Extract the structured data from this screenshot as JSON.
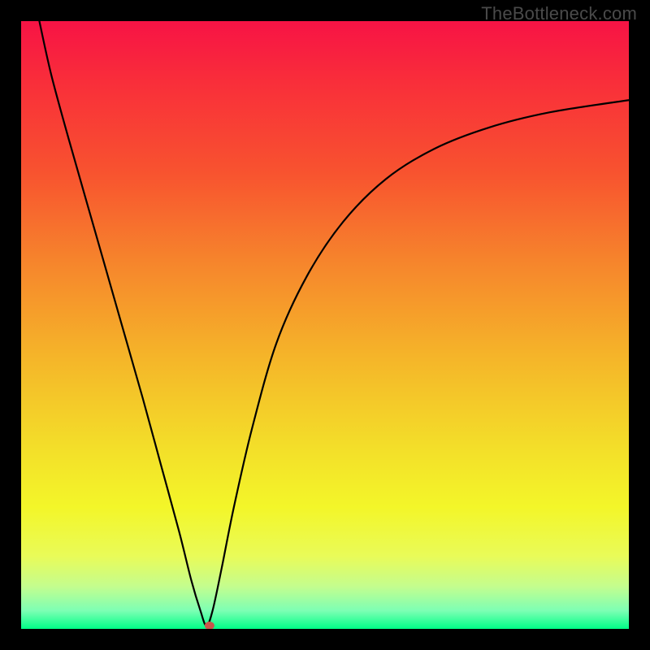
{
  "watermark": "TheBottleneck.com",
  "chart_data": {
    "type": "line",
    "title": "",
    "xlabel": "",
    "ylabel": "",
    "xlim": [
      0,
      100
    ],
    "ylim": [
      0,
      100
    ],
    "grid": false,
    "legend": false,
    "gradient_stops": [
      {
        "offset": 0.0,
        "color": "#f71345"
      },
      {
        "offset": 0.1,
        "color": "#f92e3a"
      },
      {
        "offset": 0.25,
        "color": "#f8532f"
      },
      {
        "offset": 0.4,
        "color": "#f6862c"
      },
      {
        "offset": 0.55,
        "color": "#f5b429"
      },
      {
        "offset": 0.7,
        "color": "#f3de29"
      },
      {
        "offset": 0.8,
        "color": "#f3f629"
      },
      {
        "offset": 0.88,
        "color": "#e9fb58"
      },
      {
        "offset": 0.93,
        "color": "#c4fd8e"
      },
      {
        "offset": 0.97,
        "color": "#7dffb4"
      },
      {
        "offset": 1.0,
        "color": "#00ff87"
      }
    ],
    "series": [
      {
        "name": "bottleneck-curve",
        "x": [
          3,
          5,
          8,
          12,
          16,
          20,
          23,
          26,
          28,
          29.5,
          30.5,
          31.5,
          33,
          35,
          38,
          42,
          47,
          53,
          60,
          68,
          77,
          87,
          100
        ],
        "y": [
          100,
          91,
          80,
          66,
          52,
          38,
          27,
          16,
          8,
          3,
          0.5,
          3,
          10,
          20,
          33,
          47,
          58,
          67,
          74,
          79,
          82.5,
          85,
          87
        ]
      }
    ],
    "min_marker": {
      "x": 31,
      "y": 0
    }
  }
}
